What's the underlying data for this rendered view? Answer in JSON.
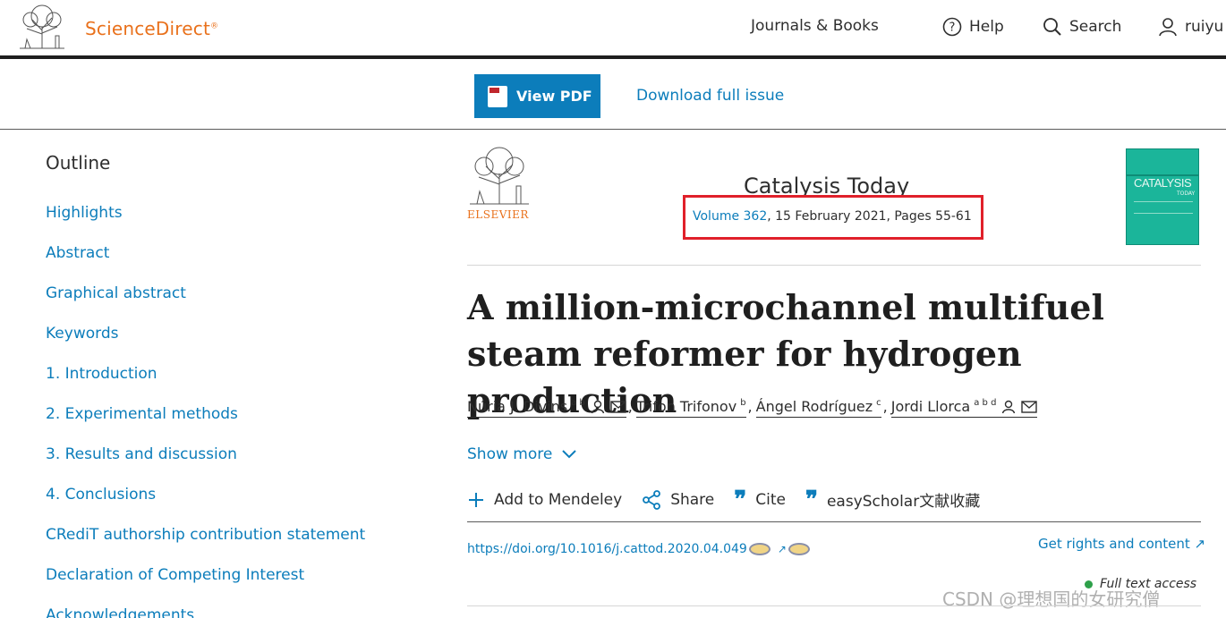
{
  "header": {
    "brand": "ScienceDirect",
    "brand_mark": "®",
    "nav": {
      "journals_books": "Journals & Books",
      "help": "Help",
      "search": "Search",
      "user": "ruiyu"
    }
  },
  "toolbar": {
    "view_pdf": "View PDF",
    "download_issue": "Download full issue"
  },
  "outline": {
    "title": "Outline",
    "items": [
      "Highlights",
      "Abstract",
      "Graphical abstract",
      "Keywords",
      "1. Introduction",
      "2. Experimental methods",
      "3. Results and discussion",
      "4. Conclusions",
      "CRediT authorship contribution statement",
      "Declaration of Competing Interest",
      "Acknowledgements"
    ]
  },
  "journal": {
    "publisher": "ELSEVIER",
    "title": "Catalysis Today",
    "volume_link": "Volume 362",
    "volume_rest": ", 15 February 2021, Pages 55-61",
    "cover_text": "CATALYSIS",
    "cover_sub": "TODAY"
  },
  "article": {
    "title": "A million-microchannel multifuel steam reformer for hydrogen production",
    "authors": [
      {
        "name": "Núria J. Divins",
        "aff": "a b"
      },
      {
        "name": "Trifon Trifonov",
        "aff": "b"
      },
      {
        "name": "Ángel Rodríguez",
        "aff": "c"
      },
      {
        "name": "Jordi Llorca",
        "aff": "a b d"
      }
    ],
    "show_more": "Show more",
    "actions": {
      "mendeley": "Add to Mendeley",
      "share": "Share",
      "cite": "Cite",
      "easyscholar": "easyScholar文献收藏"
    },
    "doi": "https://doi.org/10.1016/j.cattod.2020.04.049",
    "rights": "Get rights and content ↗",
    "full_text": "Full text access"
  },
  "watermark": "CSDN @理想国的女研究僧",
  "colors": {
    "accent": "#0c7dbb",
    "brand": "#e9711c",
    "highlight": "#e0202a"
  }
}
